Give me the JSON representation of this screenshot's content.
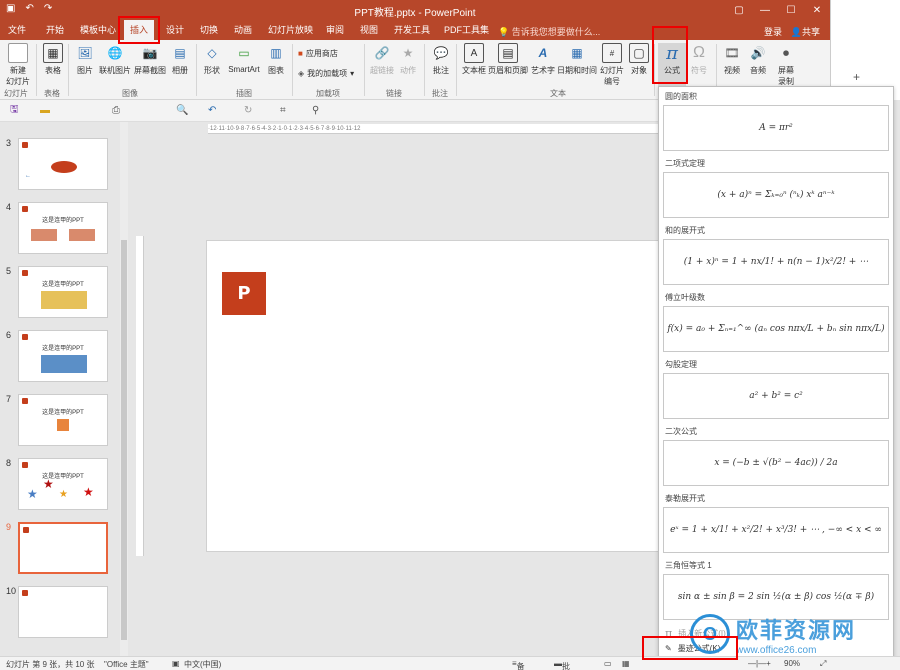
{
  "window": {
    "title": "PPT教程.pptx - PowerPoint",
    "login": "登录",
    "share": "共享"
  },
  "tabs": [
    "文件",
    "开始",
    "模板中心",
    "插入",
    "设计",
    "切换",
    "动画",
    "幻灯片放映",
    "审阅",
    "视图",
    "开发工具",
    "PDF工具集"
  ],
  "active_tab": "插入",
  "tell_me": "告诉我您想要做什么...",
  "ribbon": {
    "buttons": {
      "new_slide": "新建\n幻灯片",
      "table": "表格",
      "picture": "图片",
      "online_picture": "联机图片",
      "screenshot": "屏幕截图",
      "album": "相册",
      "shapes": "形状",
      "smartart": "SmartArt",
      "chart": "图表",
      "store": "应用商店",
      "my_addins": "我的加载项",
      "hyperlink": "超链接",
      "action": "动作",
      "comment": "批注",
      "textbox": "文本框",
      "header_footer": "页眉和页脚",
      "wordart": "艺术字",
      "datetime": "日期和时间",
      "slide_number": "幻灯片\n编号",
      "object": "对象",
      "equation": "公式",
      "symbol": "符号",
      "video": "视频",
      "audio": "音频",
      "screen_record": "屏幕\n录制"
    },
    "groups": {
      "slides": "幻灯片",
      "tables": "表格",
      "images": "图像",
      "illustrations": "插图",
      "addins": "加载项",
      "links": "链接",
      "comments": "批注",
      "text": "文本"
    }
  },
  "thumbnails": [
    {
      "num": "3",
      "title": ""
    },
    {
      "num": "4",
      "title": "这是连甲的PPT"
    },
    {
      "num": "5",
      "title": "这是连甲的PPT"
    },
    {
      "num": "6",
      "title": "这是连甲的PPT"
    },
    {
      "num": "7",
      "title": "这是连甲的PPT"
    },
    {
      "num": "8",
      "title": "这是连甲的PPT"
    },
    {
      "num": "9",
      "title": ""
    },
    {
      "num": "10",
      "title": ""
    }
  ],
  "ruler_text": "·12·11·10·9·8·7·6·5·4·3·2·1·0·1·2·3·4·5·6·7·8·9·10·11·12",
  "equations": {
    "items": [
      {
        "name": "圆的面积",
        "formula": "A = πr²"
      },
      {
        "name": "二项式定理",
        "formula": "(x + a)ⁿ = Σₖ₌₀ⁿ (ⁿₖ) xᵏ aⁿ⁻ᵏ"
      },
      {
        "name": "和的展开式",
        "formula": "(1 + x)ⁿ = 1 + nx/1! + n(n − 1)x²/2! + ⋯"
      },
      {
        "name": "傅立叶级数",
        "formula": "f(x) = a₀ + Σₙ₌₁^∞ (aₙ cos nπx/L + bₙ sin nπx/L)"
      },
      {
        "name": "勾股定理",
        "formula": "a² + b² = c²"
      },
      {
        "name": "二次公式",
        "formula": "x = (−b ± √(b² − 4ac)) / 2a"
      },
      {
        "name": "泰勒展开式",
        "formula": "eˣ = 1 + x/1! + x²/2! + x³/3! + ⋯ ,    −∞ < x < ∞"
      },
      {
        "name": "三角恒等式 1",
        "formula": "sin α ± sin β = 2 sin ½(α ± β) cos ½(α ∓ β)"
      }
    ],
    "insert_new": "插入新公式(I)",
    "ink_equation": "墨迹公式(K)"
  },
  "status": {
    "slide_info": "幻灯片 第 9 张，共 10 张",
    "theme": "\"Office 主题\"",
    "language": "中文(中国)",
    "notes": "备注",
    "comments": "批注",
    "zoom": "90%"
  },
  "watermark": {
    "brand": "欧菲资源网",
    "url": "www.office26.com"
  },
  "colors": {
    "brand": "#b7472a",
    "highlight": "#e00000",
    "selected_thumb": "#e8643c"
  }
}
